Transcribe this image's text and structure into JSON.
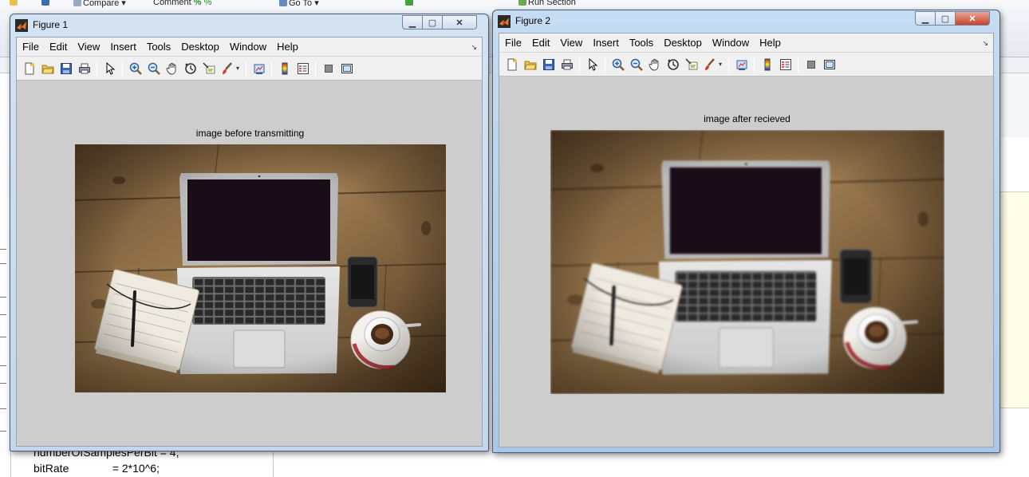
{
  "background": {
    "toolstrip": {
      "compare_label": "Compare",
      "comment_label": "Comment",
      "goto_label": "Go To",
      "run_section_label": "Run Section"
    },
    "code_lines": [
      "numberOfSamplesPerBit = 4;",
      "bitRate              = 2*10^6;"
    ]
  },
  "figures": [
    {
      "title": "Figure 1",
      "menu": [
        "File",
        "Edit",
        "View",
        "Insert",
        "Tools",
        "Desktop",
        "Window",
        "Help"
      ],
      "axes_title": "image before transmitting",
      "image_blur": "sharp"
    },
    {
      "title": "Figure 2",
      "menu": [
        "File",
        "Edit",
        "View",
        "Insert",
        "Tools",
        "Desktop",
        "Window",
        "Help"
      ],
      "axes_title": "image after recieved",
      "image_blur": "blurred"
    }
  ],
  "toolbar_icons": [
    "new-figure-icon",
    "open-file-icon",
    "save-figure-icon",
    "print-figure-icon",
    "edit-plot-arrow-icon",
    "zoom-in-icon",
    "zoom-out-icon",
    "pan-hand-icon",
    "rotate-3d-icon",
    "data-cursor-icon",
    "brush-icon",
    "link-plot-icon",
    "insert-colorbar-icon",
    "insert-legend-icon",
    "hide-plot-tools-icon",
    "show-plot-tools-icon"
  ],
  "colors": {
    "figure_background": "#cdcdcd",
    "active_title_gradient_top": "#c6dcf2",
    "close_button": "#c9442c",
    "wood": "#8a6a43",
    "screen": "#1a0d18"
  }
}
